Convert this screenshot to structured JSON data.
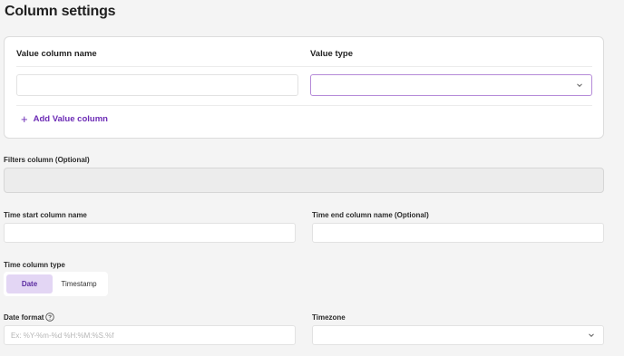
{
  "page": {
    "title": "Column settings"
  },
  "value_card": {
    "name_label": "Value column name",
    "type_label": "Value type",
    "name_value": "",
    "type_value": "",
    "add_label": "Add Value column"
  },
  "filters": {
    "label": "Filters column (Optional)",
    "value": ""
  },
  "time_start": {
    "label": "Time start column name",
    "value": ""
  },
  "time_end": {
    "label": "Time end column name (Optional)",
    "value": ""
  },
  "time_type": {
    "label": "Time column type",
    "options": [
      "Date",
      "Timestamp"
    ],
    "selected": "Date"
  },
  "date_format": {
    "label": "Date format",
    "placeholder": "Ex: %Y-%m-%d %H:%M:%S.%f",
    "value": ""
  },
  "timezone": {
    "label": "Timezone",
    "value": ""
  },
  "icons": {
    "add": "plus-icon",
    "dropdown": "chevron-down-icon",
    "help": "question-circle-icon"
  },
  "colors": {
    "accent": "#6c2bb5",
    "selected_bg": "#e3d6f4",
    "focus_border": "#b58ad8"
  }
}
